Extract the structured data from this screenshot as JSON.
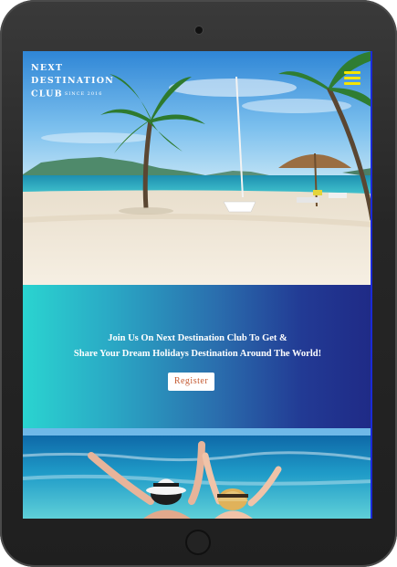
{
  "header": {
    "logo_line1": "NEXT",
    "logo_line2": "DESTINATION",
    "logo_line3": "CLUB",
    "logo_since": "SINCE 2016"
  },
  "banner": {
    "line1": "Join Us On Next Destination Club To Get &",
    "line2": "Share Your Dream Holidays Destination Around The World!",
    "register_label": "Register"
  },
  "colors": {
    "banner_gradient_start": "#2ad4d0",
    "banner_gradient_end": "#1f2a86",
    "menu_icon": "#f4e400",
    "register_text": "#c45a32"
  }
}
